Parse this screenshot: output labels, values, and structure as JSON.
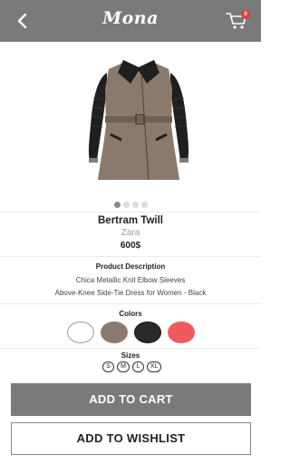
{
  "header": {
    "brand": "Mona",
    "cart_count": "0"
  },
  "product": {
    "name": "Bertram Twill",
    "brand": "Zara",
    "price": "600$",
    "image_page": 1,
    "image_pages": 4
  },
  "description": {
    "title": "Product Description",
    "lines": [
      "Chica Metallic Knit Elbow Sleeves",
      "Above-Knee Side-Tie Dress for Women - Black"
    ]
  },
  "colors": {
    "title": "Colors",
    "options": [
      "#ffffff",
      "#8b7a6c",
      "#2a2a2a",
      "#f05a5a"
    ]
  },
  "sizes": {
    "title": "Sizes",
    "options": [
      "S",
      "M",
      "L",
      "XL"
    ]
  },
  "actions": {
    "add_to_cart": "ADD TO CART",
    "add_to_wishlist": "ADD TO WISHLIST"
  }
}
